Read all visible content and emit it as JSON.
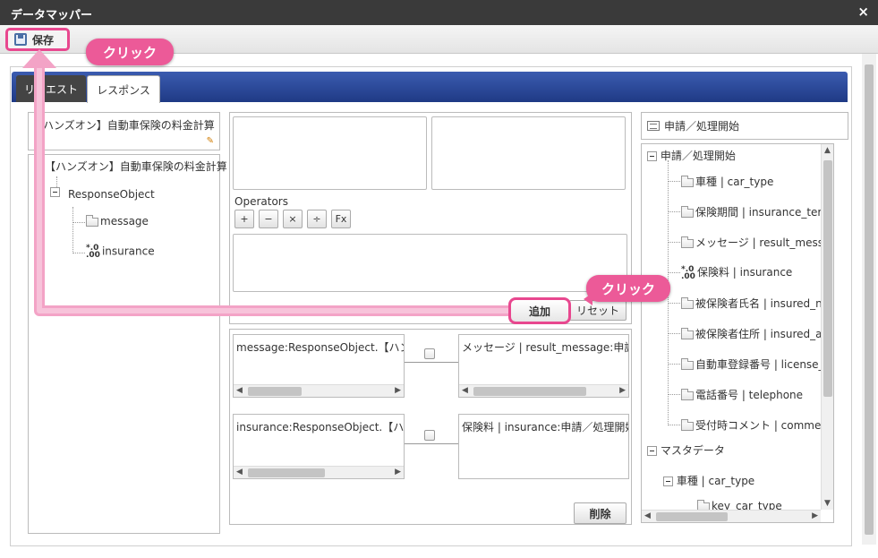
{
  "window": {
    "title": "データマッパー",
    "close": "×"
  },
  "toolbar": {
    "save_label": "保存"
  },
  "callouts": {
    "click1": "クリック",
    "click2": "クリック"
  },
  "tabs": [
    {
      "label": "リクエスト"
    },
    {
      "label": "レスポンス"
    }
  ],
  "left": {
    "header": "【ハンズオン】自動車保険の料金計算",
    "tree": {
      "root": "【ハンズオン】自動車保険の料金計算",
      "object": "ResponseObject",
      "children": [
        "message",
        "insurance"
      ]
    }
  },
  "middle": {
    "operators_label": "Operators",
    "operators": [
      "+",
      "−",
      "×",
      "÷",
      "Fx"
    ],
    "add_label": "追加",
    "reset_label": "リセット",
    "mappings": [
      {
        "source": "message:ResponseObject.【ハンズオン】",
        "target": "メッセージ | result_message:申請／処理開始"
      },
      {
        "source": "insurance:ResponseObject.【ハンズオン】",
        "target": "保険料 | insurance:申請／処理開始"
      }
    ],
    "delete_label": "削除"
  },
  "right": {
    "header": "申請／処理開始",
    "tree": {
      "root": "申請／処理開始",
      "items": [
        "車種 | car_type",
        "保険期間 | insurance_term",
        "メッセージ | result_message",
        "保険料 | insurance",
        "被保険者氏名 | insured_name",
        "被保険者住所 | insured_address",
        "自動車登録番号 | license_plate",
        "電話番号 | telephone",
        "受付時コメント | comment"
      ],
      "master": "マスタデータ",
      "master_child": "車種 | car_type",
      "master_leaf": "key_car_type"
    }
  }
}
